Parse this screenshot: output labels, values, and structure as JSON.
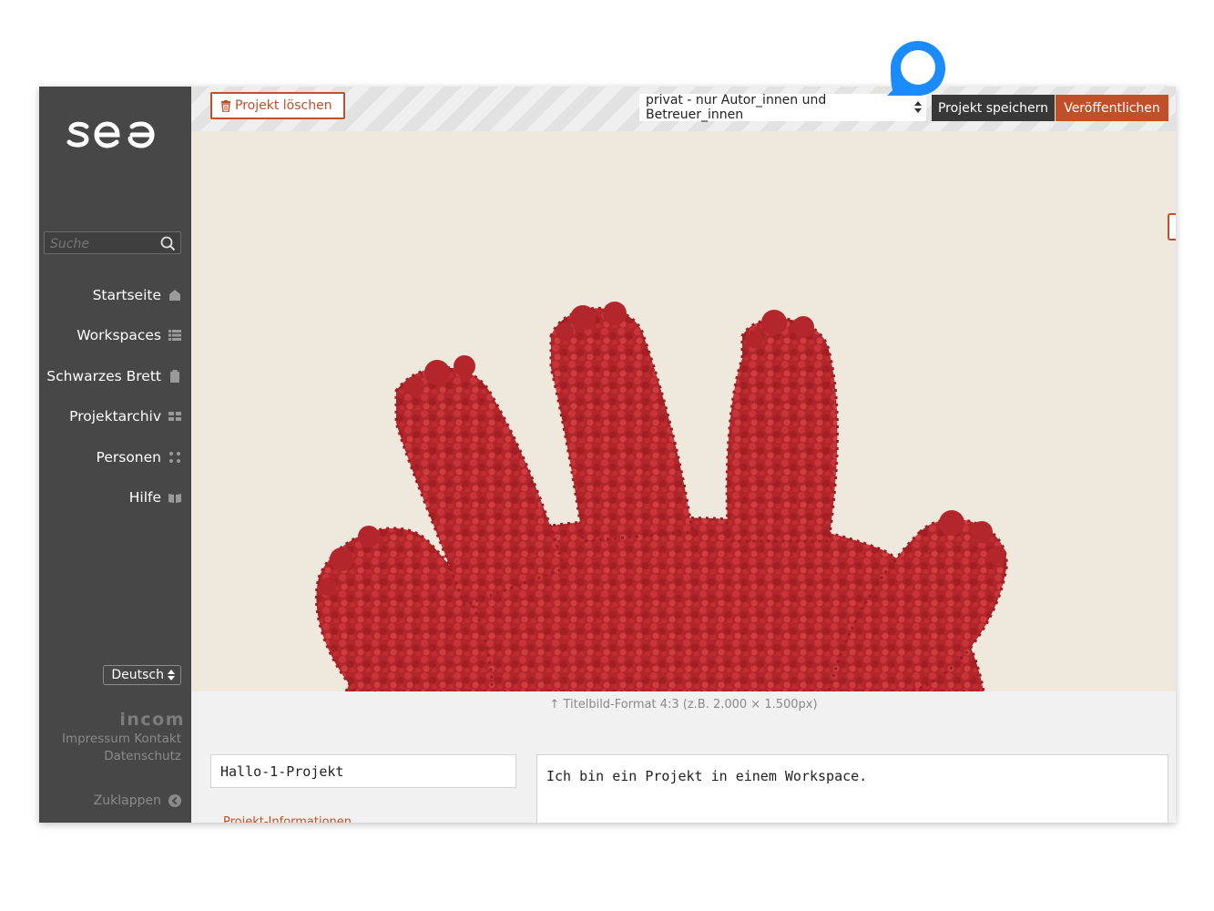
{
  "app": {
    "logo_text": "see",
    "brand": "incom"
  },
  "sidebar": {
    "search_placeholder": "Suche",
    "items": [
      {
        "label": "Startseite",
        "icon": "home-icon"
      },
      {
        "label": "Workspaces",
        "icon": "list-icon"
      },
      {
        "label": "Schwarzes Brett",
        "icon": "clipboard-icon"
      },
      {
        "label": "Projektarchiv",
        "icon": "grid-icon"
      },
      {
        "label": "Personen",
        "icon": "people-icon"
      },
      {
        "label": "Hilfe",
        "icon": "book-icon"
      }
    ],
    "language": "Deutsch",
    "footer_links": [
      "Impressum",
      "Kontakt",
      "Datenschutz"
    ],
    "collapse_label": "Zuklappen"
  },
  "toolbar": {
    "delete_label": "Projekt löschen",
    "visibility_value": "privat - nur Autor_innen und Betreuer_innen",
    "save_label": "Projekt speichern",
    "publish_label": "Veröffentlichen"
  },
  "cover": {
    "hint": "Titelbild-Format 4:3 (z.B. 2.000 × 1.500px)"
  },
  "project": {
    "title": "Hallo-1-Projekt",
    "description": "Ich bin ein Projekt in einem Workspace.",
    "info_link": "Projekt-Informationen"
  },
  "colors": {
    "accent": "#c0502a",
    "sidebar": "#474747",
    "marker": "#1a8cff"
  }
}
